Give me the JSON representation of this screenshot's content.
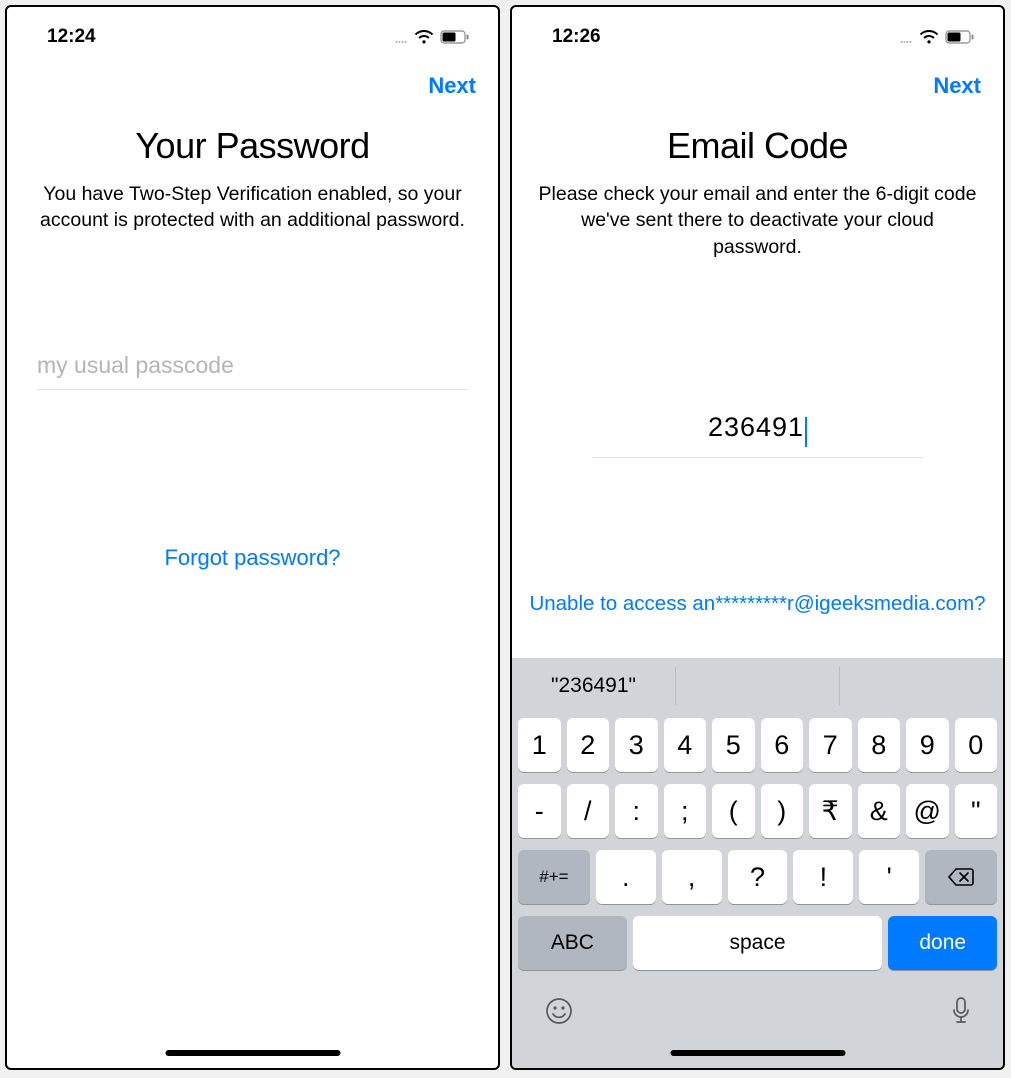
{
  "left": {
    "status": {
      "time": "12:24"
    },
    "nav": {
      "next": "Next"
    },
    "title": "Your Password",
    "subtitle": "You have Two-Step Verification enabled, so your account is protected with an additional password.",
    "input": {
      "placeholder": "my usual passcode"
    },
    "forgot": "Forgot password?"
  },
  "right": {
    "status": {
      "time": "12:26"
    },
    "nav": {
      "next": "Next"
    },
    "title": "Email Code",
    "subtitle": "Please check your email and enter the 6-digit code we've sent there to deactivate your cloud password.",
    "input": {
      "value": "236491"
    },
    "access_link": "Unable to access an*********r@igeeksmedia.com?",
    "keyboard": {
      "suggestion": "\"236491\"",
      "row1": [
        "1",
        "2",
        "3",
        "4",
        "5",
        "6",
        "7",
        "8",
        "9",
        "0"
      ],
      "row2": [
        "-",
        "/",
        ":",
        ";",
        "(",
        ")",
        "₹",
        "&",
        "@",
        "\""
      ],
      "row3_shift": "#+=",
      "row3": [
        ".",
        ",",
        "?",
        "!",
        "'"
      ],
      "abc": "ABC",
      "space": "space",
      "done": "done"
    }
  }
}
